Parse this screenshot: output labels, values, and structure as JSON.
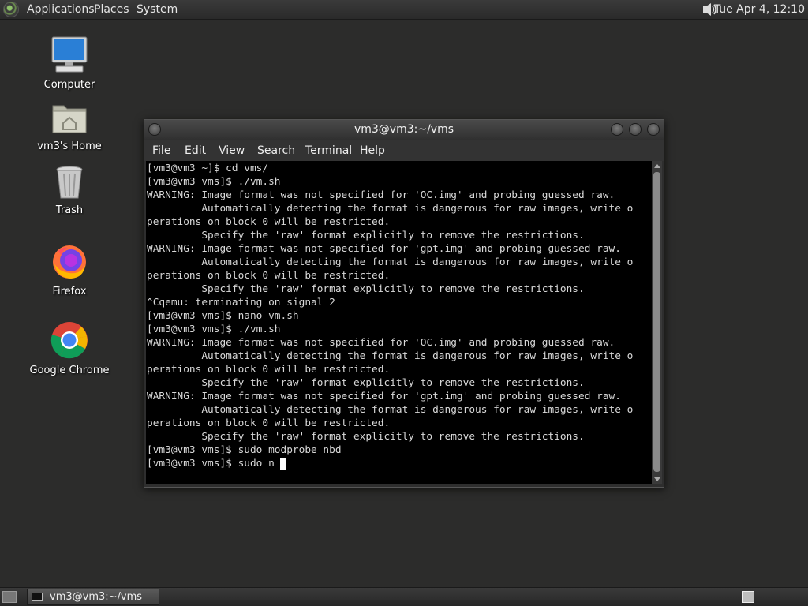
{
  "top_panel": {
    "menus": [
      "Applications",
      "Places",
      "System"
    ],
    "clock": "Tue Apr  4, 12:10",
    "volume_icon": "volume-icon"
  },
  "desktop": {
    "icons": [
      {
        "label": "Computer",
        "icon": "computer-icon"
      },
      {
        "label": "vm3's Home",
        "icon": "home-folder-icon"
      },
      {
        "label": "Trash",
        "icon": "trash-icon"
      },
      {
        "label": "Firefox",
        "icon": "firefox-icon"
      },
      {
        "label": "Google Chrome",
        "icon": "chrome-icon"
      }
    ]
  },
  "terminal": {
    "title": "vm3@vm3:~/vms",
    "menu": [
      "File",
      "Edit",
      "View",
      "Search",
      "Terminal",
      "Help"
    ],
    "lines": [
      "[vm3@vm3 ~]$ cd vms/",
      "[vm3@vm3 vms]$ ./vm.sh",
      "WARNING: Image format was not specified for 'OC.img' and probing guessed raw.",
      "         Automatically detecting the format is dangerous for raw images, write o",
      "perations on block 0 will be restricted.",
      "         Specify the 'raw' format explicitly to remove the restrictions.",
      "WARNING: Image format was not specified for 'gpt.img' and probing guessed raw.",
      "         Automatically detecting the format is dangerous for raw images, write o",
      "perations on block 0 will be restricted.",
      "         Specify the 'raw' format explicitly to remove the restrictions.",
      "^Cqemu: terminating on signal 2",
      "[vm3@vm3 vms]$ nano vm.sh",
      "[vm3@vm3 vms]$ ./vm.sh",
      "WARNING: Image format was not specified for 'OC.img' and probing guessed raw.",
      "         Automatically detecting the format is dangerous for raw images, write o",
      "perations on block 0 will be restricted.",
      "         Specify the 'raw' format explicitly to remove the restrictions.",
      "WARNING: Image format was not specified for 'gpt.img' and probing guessed raw.",
      "         Automatically detecting the format is dangerous for raw images, write o",
      "perations on block 0 will be restricted.",
      "         Specify the 'raw' format explicitly to remove the restrictions.",
      "[vm3@vm3 vms]$ sudo modprobe nbd",
      "[vm3@vm3 vms]$ sudo n"
    ]
  },
  "bottom_panel": {
    "task_label": "vm3@vm3:~/vms"
  }
}
